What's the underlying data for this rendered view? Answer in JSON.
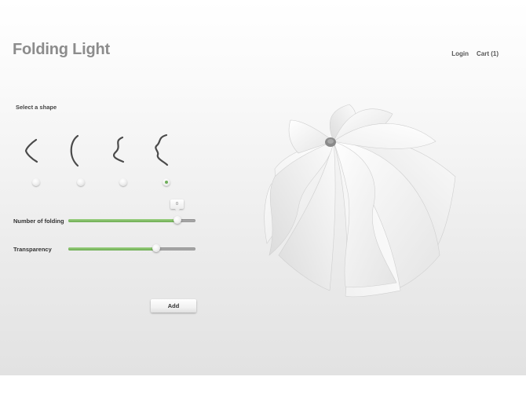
{
  "brand": {
    "title": "Folding Light"
  },
  "nav": {
    "login": "Login",
    "cart": "Cart (1)"
  },
  "shape_selector": {
    "label": "Select a shape",
    "shapes": [
      {
        "icon": "angle-curve-icon"
      },
      {
        "icon": "arc-curve-icon"
      },
      {
        "icon": "double-wave-icon"
      },
      {
        "icon": "triple-wave-icon"
      }
    ],
    "selected_index": 3
  },
  "sliders": {
    "folding": {
      "label": "Number of folding",
      "value_fraction": 0.86,
      "tooltip": "0"
    },
    "transparency": {
      "label": "Transparency",
      "value_fraction": 0.69
    }
  },
  "actions": {
    "add_label": "Add"
  },
  "colors": {
    "accent_green": "#6cac52",
    "title_gray": "#8c8c8c"
  },
  "product": {
    "image": "folded-paper-lamp"
  }
}
